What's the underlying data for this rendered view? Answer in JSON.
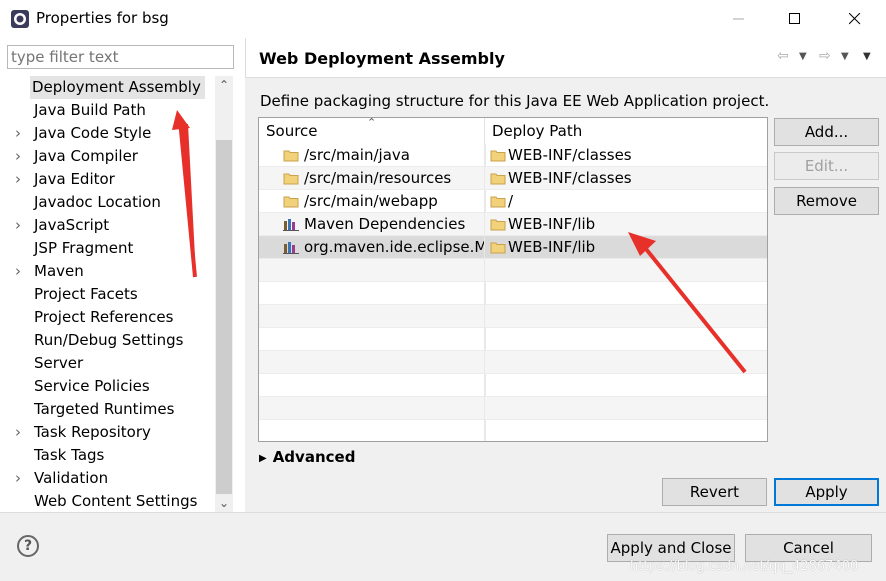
{
  "window": {
    "title": "Properties for bsg",
    "controls": {
      "minimize": "—",
      "maximize": "☐",
      "close": "✕"
    }
  },
  "filter": {
    "placeholder": "type filter text",
    "value": ""
  },
  "tree": {
    "items": [
      {
        "label": "Deployment Assembly",
        "expandable": false,
        "selected": true
      },
      {
        "label": "Java Build Path",
        "expandable": false
      },
      {
        "label": "Java Code Style",
        "expandable": true
      },
      {
        "label": "Java Compiler",
        "expandable": true
      },
      {
        "label": "Java Editor",
        "expandable": true
      },
      {
        "label": "Javadoc Location",
        "expandable": false
      },
      {
        "label": "JavaScript",
        "expandable": true
      },
      {
        "label": "JSP Fragment",
        "expandable": false
      },
      {
        "label": "Maven",
        "expandable": true
      },
      {
        "label": "Project Facets",
        "expandable": false
      },
      {
        "label": "Project References",
        "expandable": false
      },
      {
        "label": "Run/Debug Settings",
        "expandable": false
      },
      {
        "label": "Server",
        "expandable": false
      },
      {
        "label": "Service Policies",
        "expandable": false
      },
      {
        "label": "Targeted Runtimes",
        "expandable": false
      },
      {
        "label": "Task Repository",
        "expandable": true
      },
      {
        "label": "Task Tags",
        "expandable": false
      },
      {
        "label": "Validation",
        "expandable": true
      },
      {
        "label": "Web Content Settings",
        "expandable": false
      }
    ]
  },
  "page": {
    "title": "Web Deployment Assembly",
    "description": "Define packaging structure for this Java EE Web Application project.",
    "table": {
      "columns": [
        "Source",
        "Deploy Path"
      ],
      "rows": [
        {
          "source": "/src/main/java",
          "source_icon": "folder-icon",
          "deploy": "WEB-INF/classes"
        },
        {
          "source": "/src/main/resources",
          "source_icon": "folder-icon",
          "deploy": "WEB-INF/classes"
        },
        {
          "source": "/src/main/webapp",
          "source_icon": "folder-icon",
          "deploy": "/"
        },
        {
          "source": "Maven Dependencies",
          "source_icon": "library-icon",
          "deploy": "WEB-INF/lib"
        },
        {
          "source": "org.maven.ide.eclipse.M...",
          "source_icon": "library-icon",
          "deploy": "WEB-INF/lib",
          "selected": true
        }
      ]
    },
    "buttons": {
      "add": "Add...",
      "edit": "Edit...",
      "remove": "Remove",
      "revert": "Revert",
      "apply": "Apply"
    },
    "advanced": "Advanced"
  },
  "footer": {
    "help": "?",
    "apply_close": "Apply and Close",
    "cancel": "Cancel",
    "watermark": "https://blog.csdn.net/qq_42867400"
  },
  "colors": {
    "annotation_arrow": "#e8302a",
    "default_button_border": "#0078d7",
    "folder": "#e8c56a"
  }
}
